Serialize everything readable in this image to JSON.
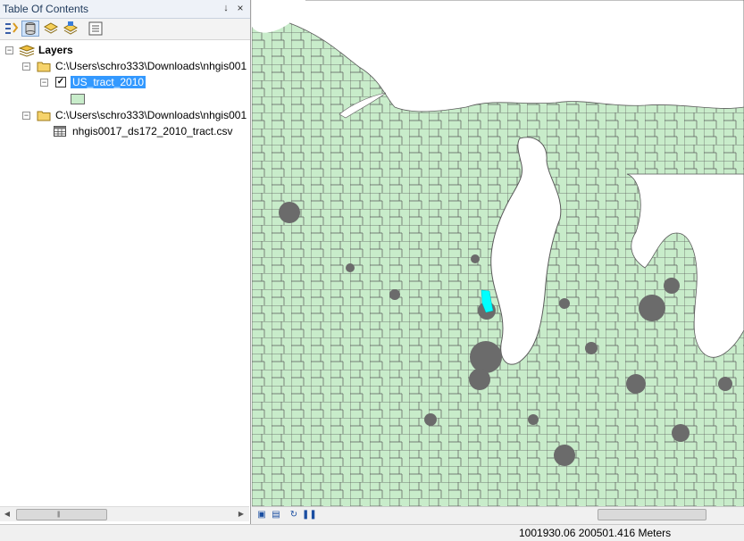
{
  "toc": {
    "title": "Table Of Contents",
    "pin_glyph": "↓",
    "close_glyph": "×",
    "toolbar": [
      "list-by-drawing-order-icon",
      "list-by-source-icon",
      "list-by-visibility-icon",
      "list-by-selection-icon",
      "options-icon"
    ],
    "tree": {
      "root_label": "Layers",
      "items": [
        {
          "type": "folder",
          "label": "C:\\Users\\schro333\\Downloads\\nhgis001"
        },
        {
          "type": "layer",
          "label": "US_tract_2010",
          "checked": true,
          "selected": true,
          "symbol_color": "#c8ecca"
        },
        {
          "type": "folder",
          "label": "C:\\Users\\schro333\\Downloads\\nhgis001"
        },
        {
          "type": "table",
          "label": "nhgis0017_ds172_2010_tract.csv"
        }
      ]
    }
  },
  "map": {
    "tract_fill": "#c8ecca",
    "tract_outline": "#5a5a5a",
    "water_color": "#ffffff",
    "highlight_color": "#00ffff",
    "footer_buttons": [
      "data-view-icon",
      "layout-view-icon",
      "refresh-icon",
      "pause-drawing-icon"
    ]
  },
  "status": {
    "coordinates": "1001930.06  200501.416 Meters"
  }
}
